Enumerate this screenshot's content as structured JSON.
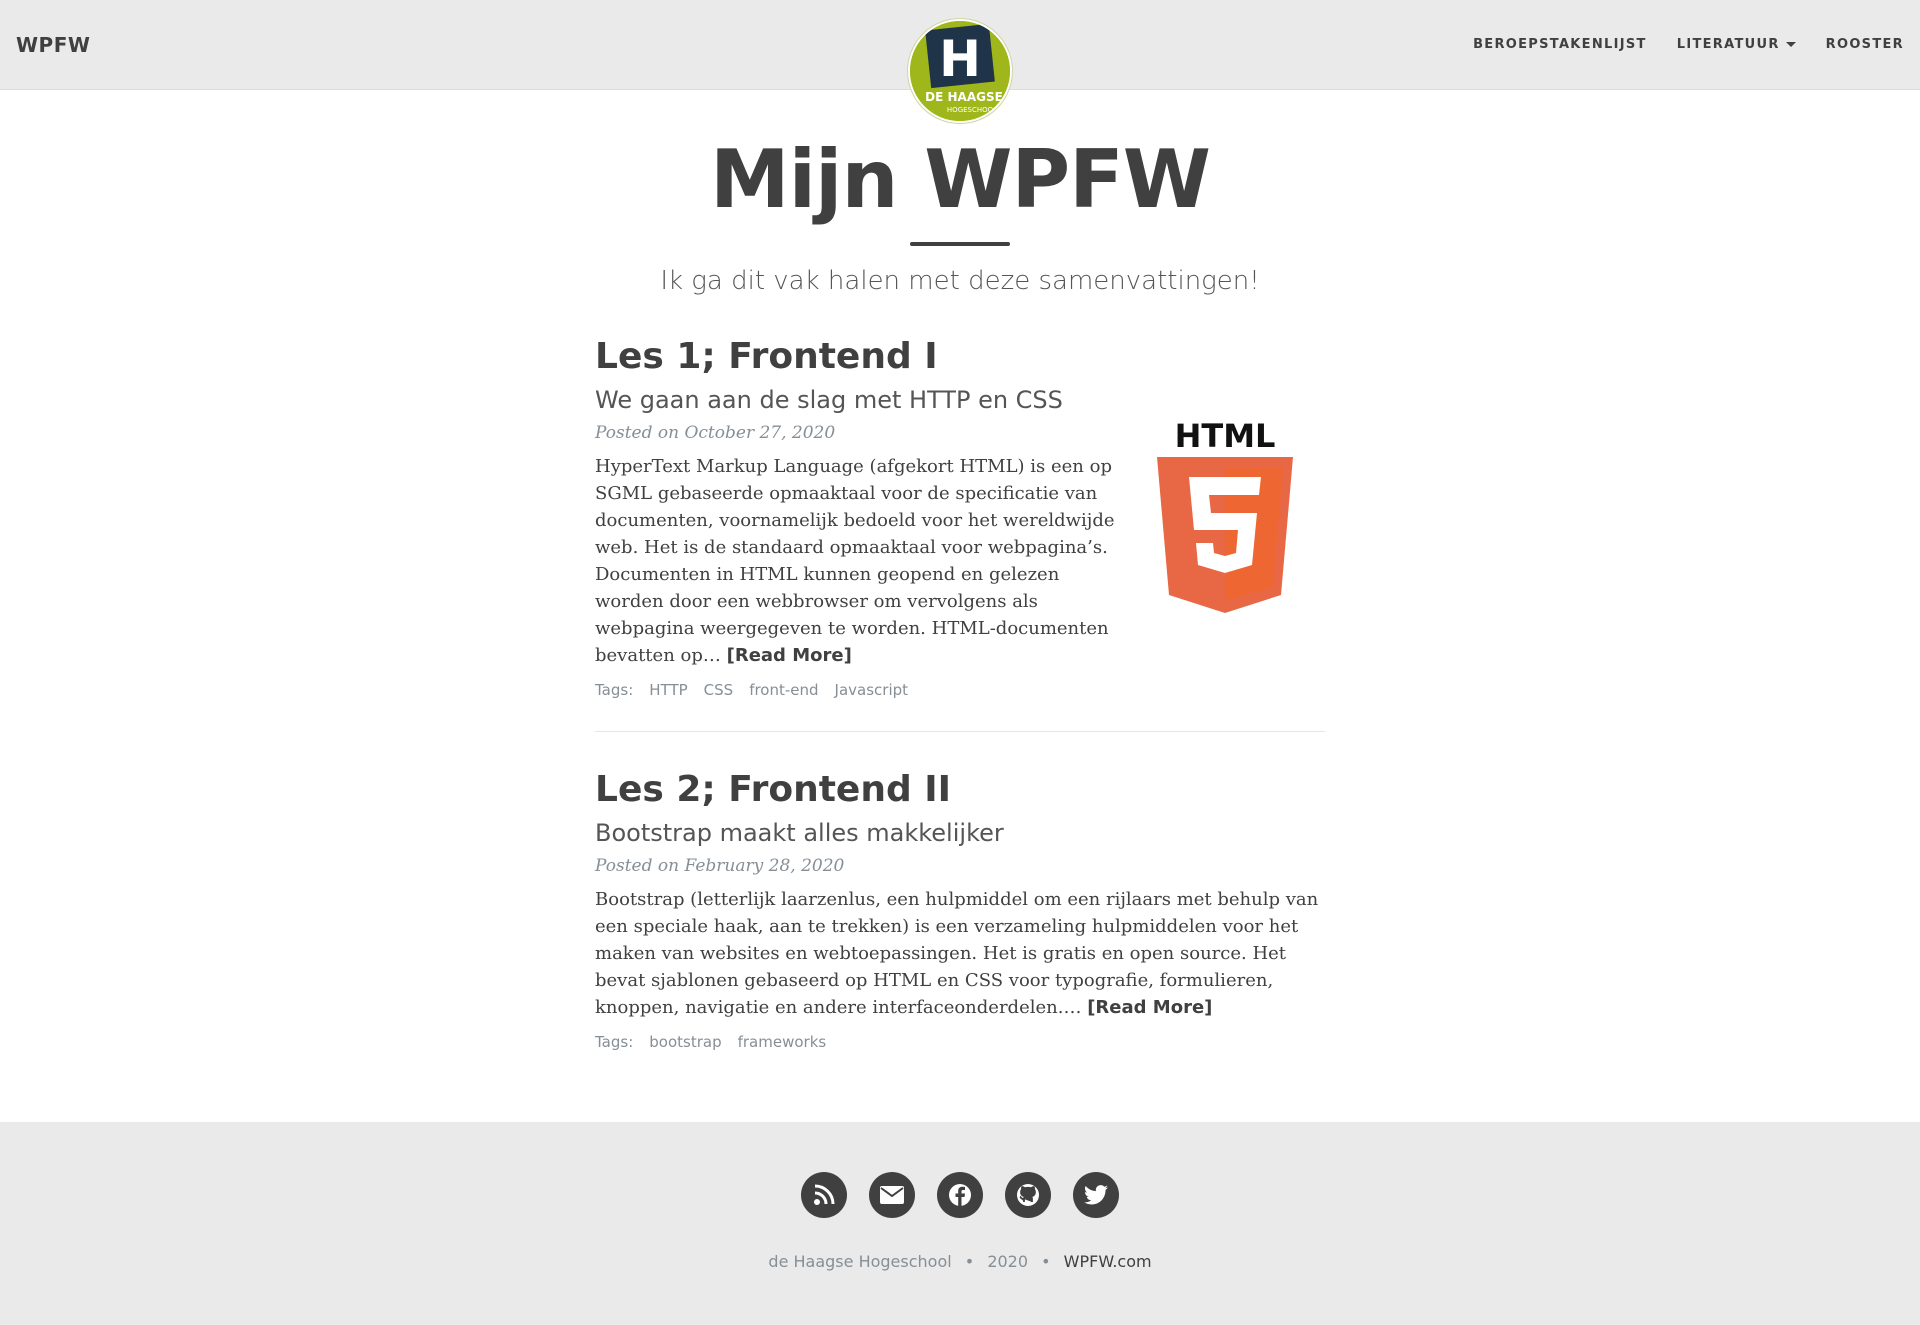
{
  "navbar": {
    "brand": "WPFW",
    "links": [
      {
        "label": "BEROEPSTAKENLIJST"
      },
      {
        "label": "LITERATUUR"
      },
      {
        "label": "ROOSTER"
      }
    ],
    "logo": {
      "letter": "H",
      "line1": "DE HAAGSE",
      "line2": "HOGESCHOOL",
      "color": "#9fb71a"
    }
  },
  "header": {
    "title": "Mijn WPFW",
    "subtitle": "Ik ga dit vak halen met deze samenvattingen!"
  },
  "posts": [
    {
      "title": "Les 1; Frontend I",
      "subtitle": "We gaan aan de slag met HTTP en CSS",
      "meta": "Posted on October 27, 2020",
      "excerpt": "HyperText Markup Language (afgekort HTML) is een op SGML gebaseerde opmaaktaal voor de specificatie van documenten, voornamelijk bedoeld voor het wereldwijde web. Het is de standaard opmaaktaal voor webpagina’s. Documenten in HTML kunnen geopend en gelezen worden door een webbrowser om vervolgens als webpagina weergegeven te worden. HTML-documenten bevatten op…",
      "read_more": "[Read More]",
      "tags_label": "Tags:",
      "tags": [
        "HTTP",
        "CSS",
        "front-end",
        "Javascript"
      ],
      "image": {
        "text": "HTML",
        "number": "5",
        "icon": "html5-logo"
      }
    },
    {
      "title": "Les 2; Frontend II",
      "subtitle": "Bootstrap maakt alles makkelijker",
      "meta": "Posted on February 28, 2020",
      "excerpt": "Bootstrap (letterlijk laarzenlus, een hulpmiddel om een rijlaars met behulp van een speciale haak, aan te trekken) is een verzameling hulpmiddelen voor het maken van websites en webtoepassingen. Het is gratis en open source. Het bevat sjablonen gebaseerd op HTML en CSS voor typografie, formulieren, knoppen, navigatie en andere interfaceonderdelen.…",
      "read_more": "[Read More]",
      "tags_label": "Tags:",
      "tags": [
        "bootstrap",
        "frameworks"
      ]
    }
  ],
  "footer": {
    "social": [
      "rss-icon",
      "envelope-icon",
      "facebook-icon",
      "github-icon",
      "twitter-icon"
    ],
    "org": "de Haagse Hogeschool",
    "year": "2020",
    "site": "WPFW.com",
    "separator": "•"
  }
}
